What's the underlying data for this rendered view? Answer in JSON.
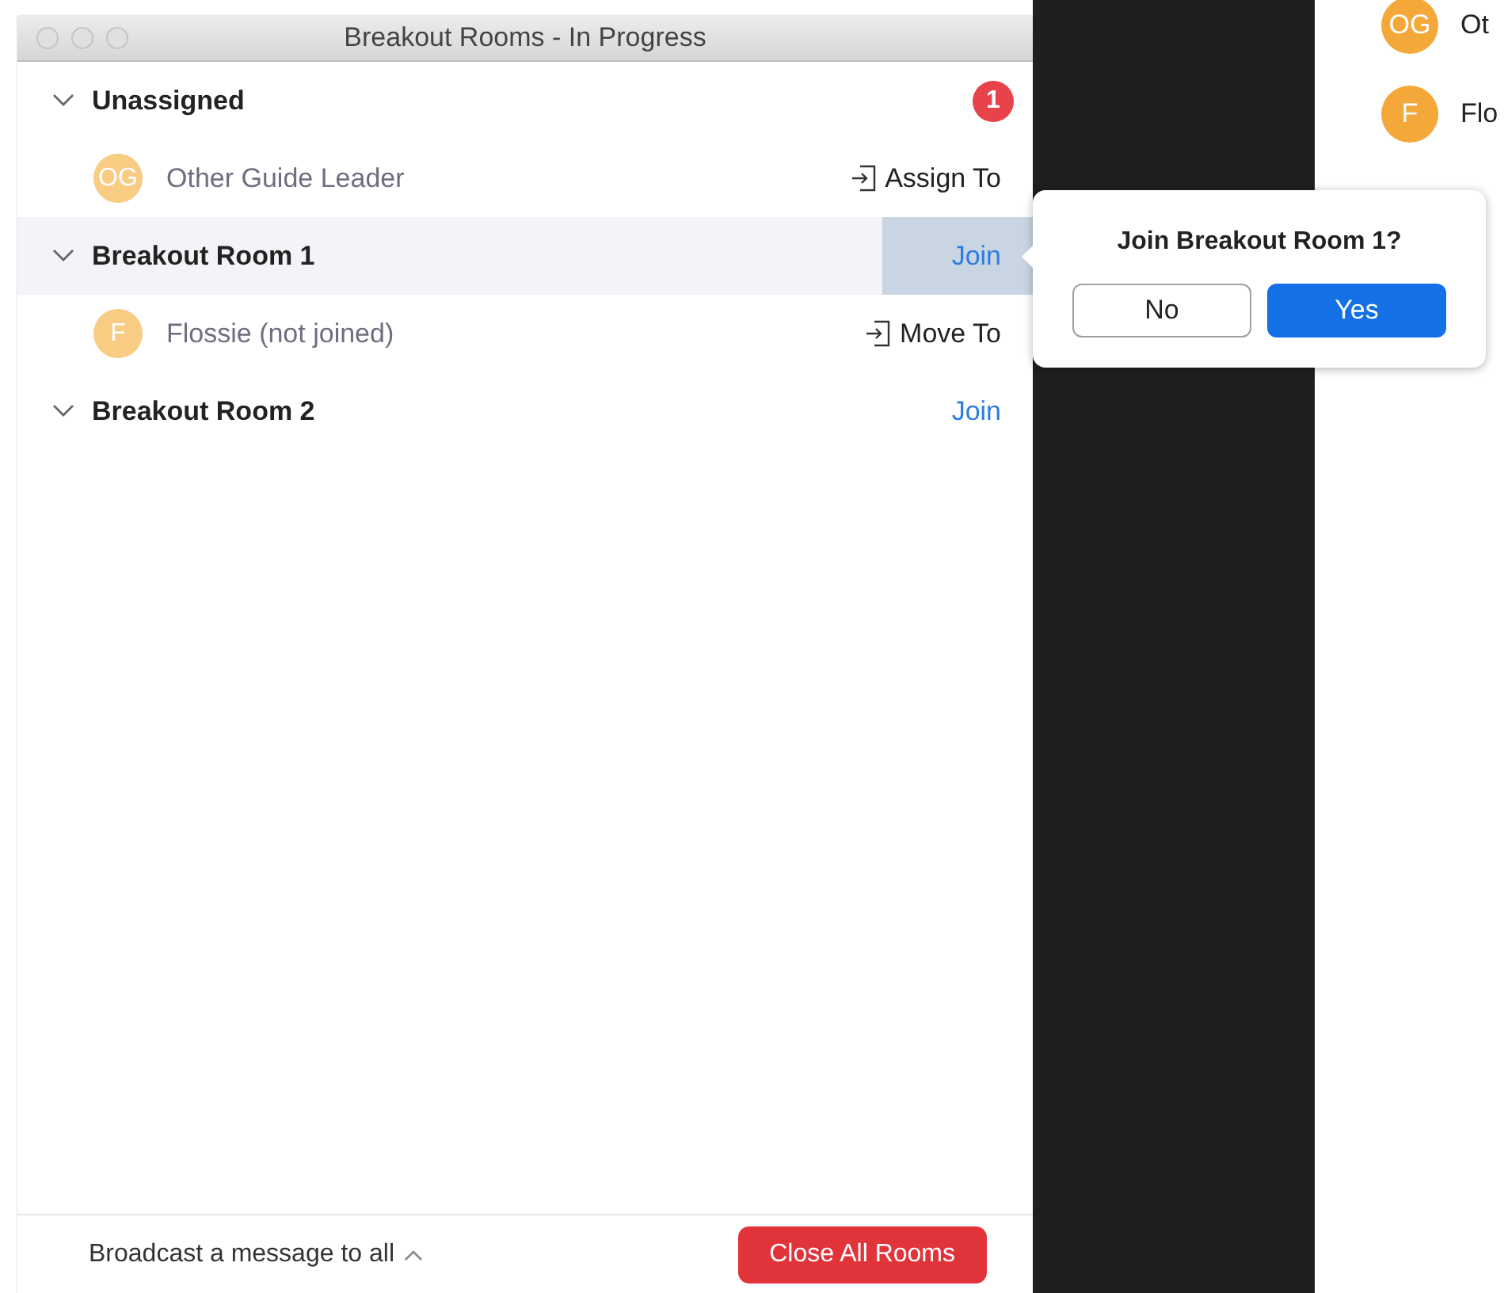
{
  "window": {
    "title": "Breakout Rooms - In Progress"
  },
  "groups": [
    {
      "name": "Unassigned",
      "expanded": true,
      "selected": false,
      "badge": "1",
      "participants": [
        {
          "initials": "OG",
          "name": "Other Guide Leader",
          "action": "Assign To"
        }
      ]
    },
    {
      "name": "Breakout Room 1",
      "expanded": true,
      "selected": true,
      "action": "Join",
      "participants": [
        {
          "initials": "F",
          "name": "Flossie (not joined)",
          "action": "Move To"
        }
      ]
    },
    {
      "name": "Breakout Room 2",
      "expanded": true,
      "selected": false,
      "action": "Join"
    }
  ],
  "footer": {
    "broadcast": "Broadcast a message to all",
    "close_button": "Close All Rooms"
  },
  "popup": {
    "question": "Join Breakout Room 1?",
    "buttons": [
      {
        "label": "No",
        "kind": "secondary"
      },
      {
        "label": "Yes",
        "kind": "primary"
      }
    ]
  },
  "side_participants": [
    {
      "initials": "OG",
      "name": "Ot"
    },
    {
      "initials": "F",
      "name": "Flo"
    }
  ]
}
